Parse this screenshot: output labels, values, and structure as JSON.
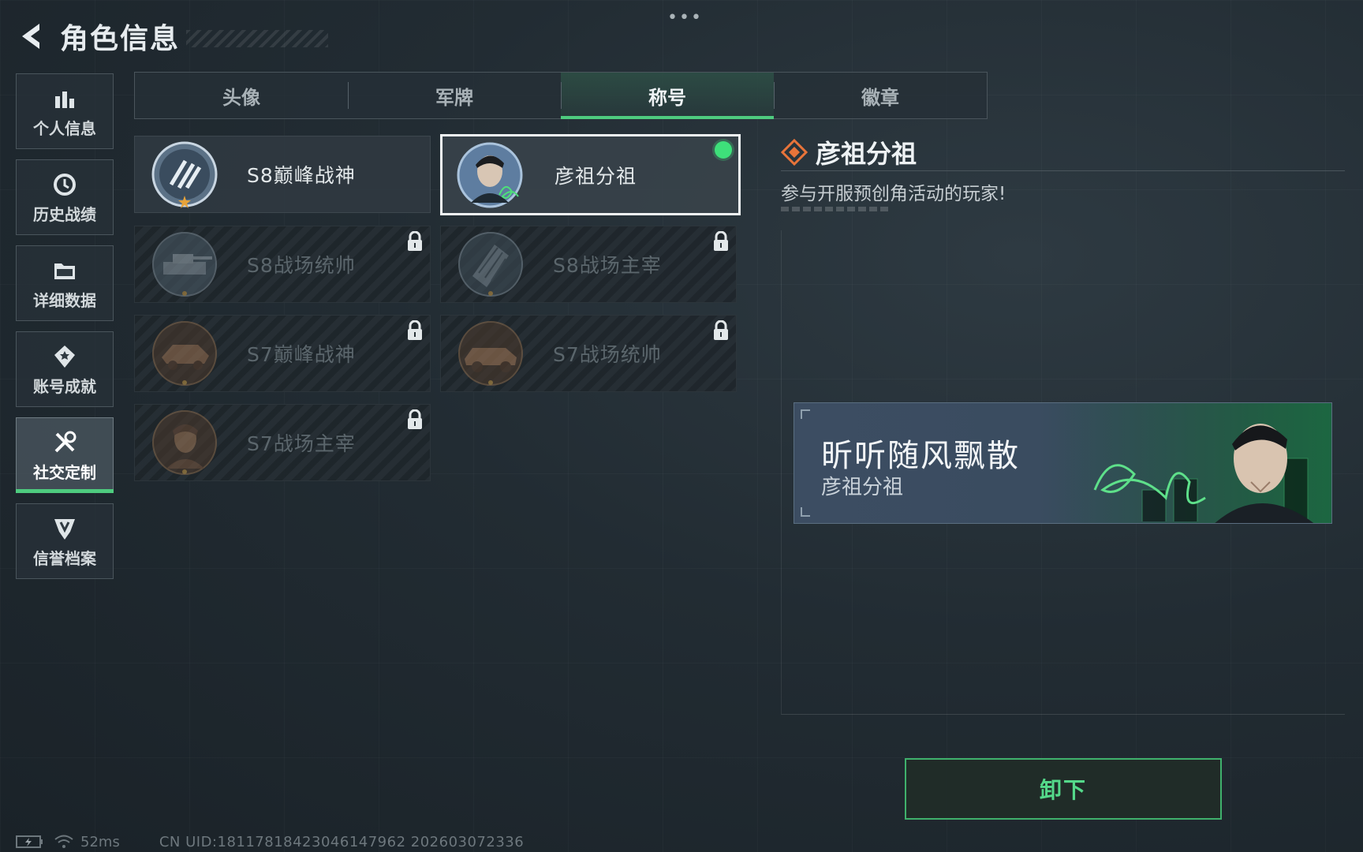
{
  "header": {
    "title": "角色信息",
    "more": "•••"
  },
  "sidebar": {
    "items": [
      {
        "label": "个人信息",
        "icon": "bar-chart-icon",
        "active": false
      },
      {
        "label": "历史战绩",
        "icon": "clock-history-icon",
        "active": false
      },
      {
        "label": "详细数据",
        "icon": "folder-icon",
        "active": false
      },
      {
        "label": "账号成就",
        "icon": "medal-icon",
        "active": false
      },
      {
        "label": "社交定制",
        "icon": "tools-icon",
        "active": true
      },
      {
        "label": "信誉档案",
        "icon": "shield-badge-icon",
        "active": false
      }
    ]
  },
  "tabs": [
    {
      "label": "头像",
      "active": false
    },
    {
      "label": "军牌",
      "active": false
    },
    {
      "label": "称号",
      "active": true
    },
    {
      "label": "徽章",
      "active": false
    }
  ],
  "titles": [
    {
      "name": "S8巅峰战神",
      "locked": false,
      "selected": false,
      "emblem": "s8-peak-emblem"
    },
    {
      "name": "彦祖分祖",
      "locked": false,
      "selected": true,
      "emblem": "portrait-emblem"
    },
    {
      "name": "S8战场统帅",
      "locked": true,
      "selected": false,
      "emblem": "tank-emblem"
    },
    {
      "name": "S8战场主宰",
      "locked": true,
      "selected": false,
      "emblem": "tower-emblem"
    },
    {
      "name": "S7巅峰战神",
      "locked": true,
      "selected": false,
      "emblem": "vehicle-emblem"
    },
    {
      "name": "S7战场统帅",
      "locked": true,
      "selected": false,
      "emblem": "car-emblem"
    },
    {
      "name": "S7战场主宰",
      "locked": true,
      "selected": false,
      "emblem": "soldier-emblem"
    }
  ],
  "detail": {
    "title": "彦祖分祖",
    "description": "参与开服预创角活动的玩家!",
    "banner": {
      "player_name": "昕听随风飘散",
      "title": "彦祖分祖"
    }
  },
  "actions": {
    "unequip_label": "卸下"
  },
  "status": {
    "ping": "52ms",
    "uid": "CN UID:1811781842304614796​2 202603072336"
  },
  "colors": {
    "accent": "#4ecb7f",
    "selected_dot": "#3ee07a",
    "title_icon": "#e8743a"
  }
}
